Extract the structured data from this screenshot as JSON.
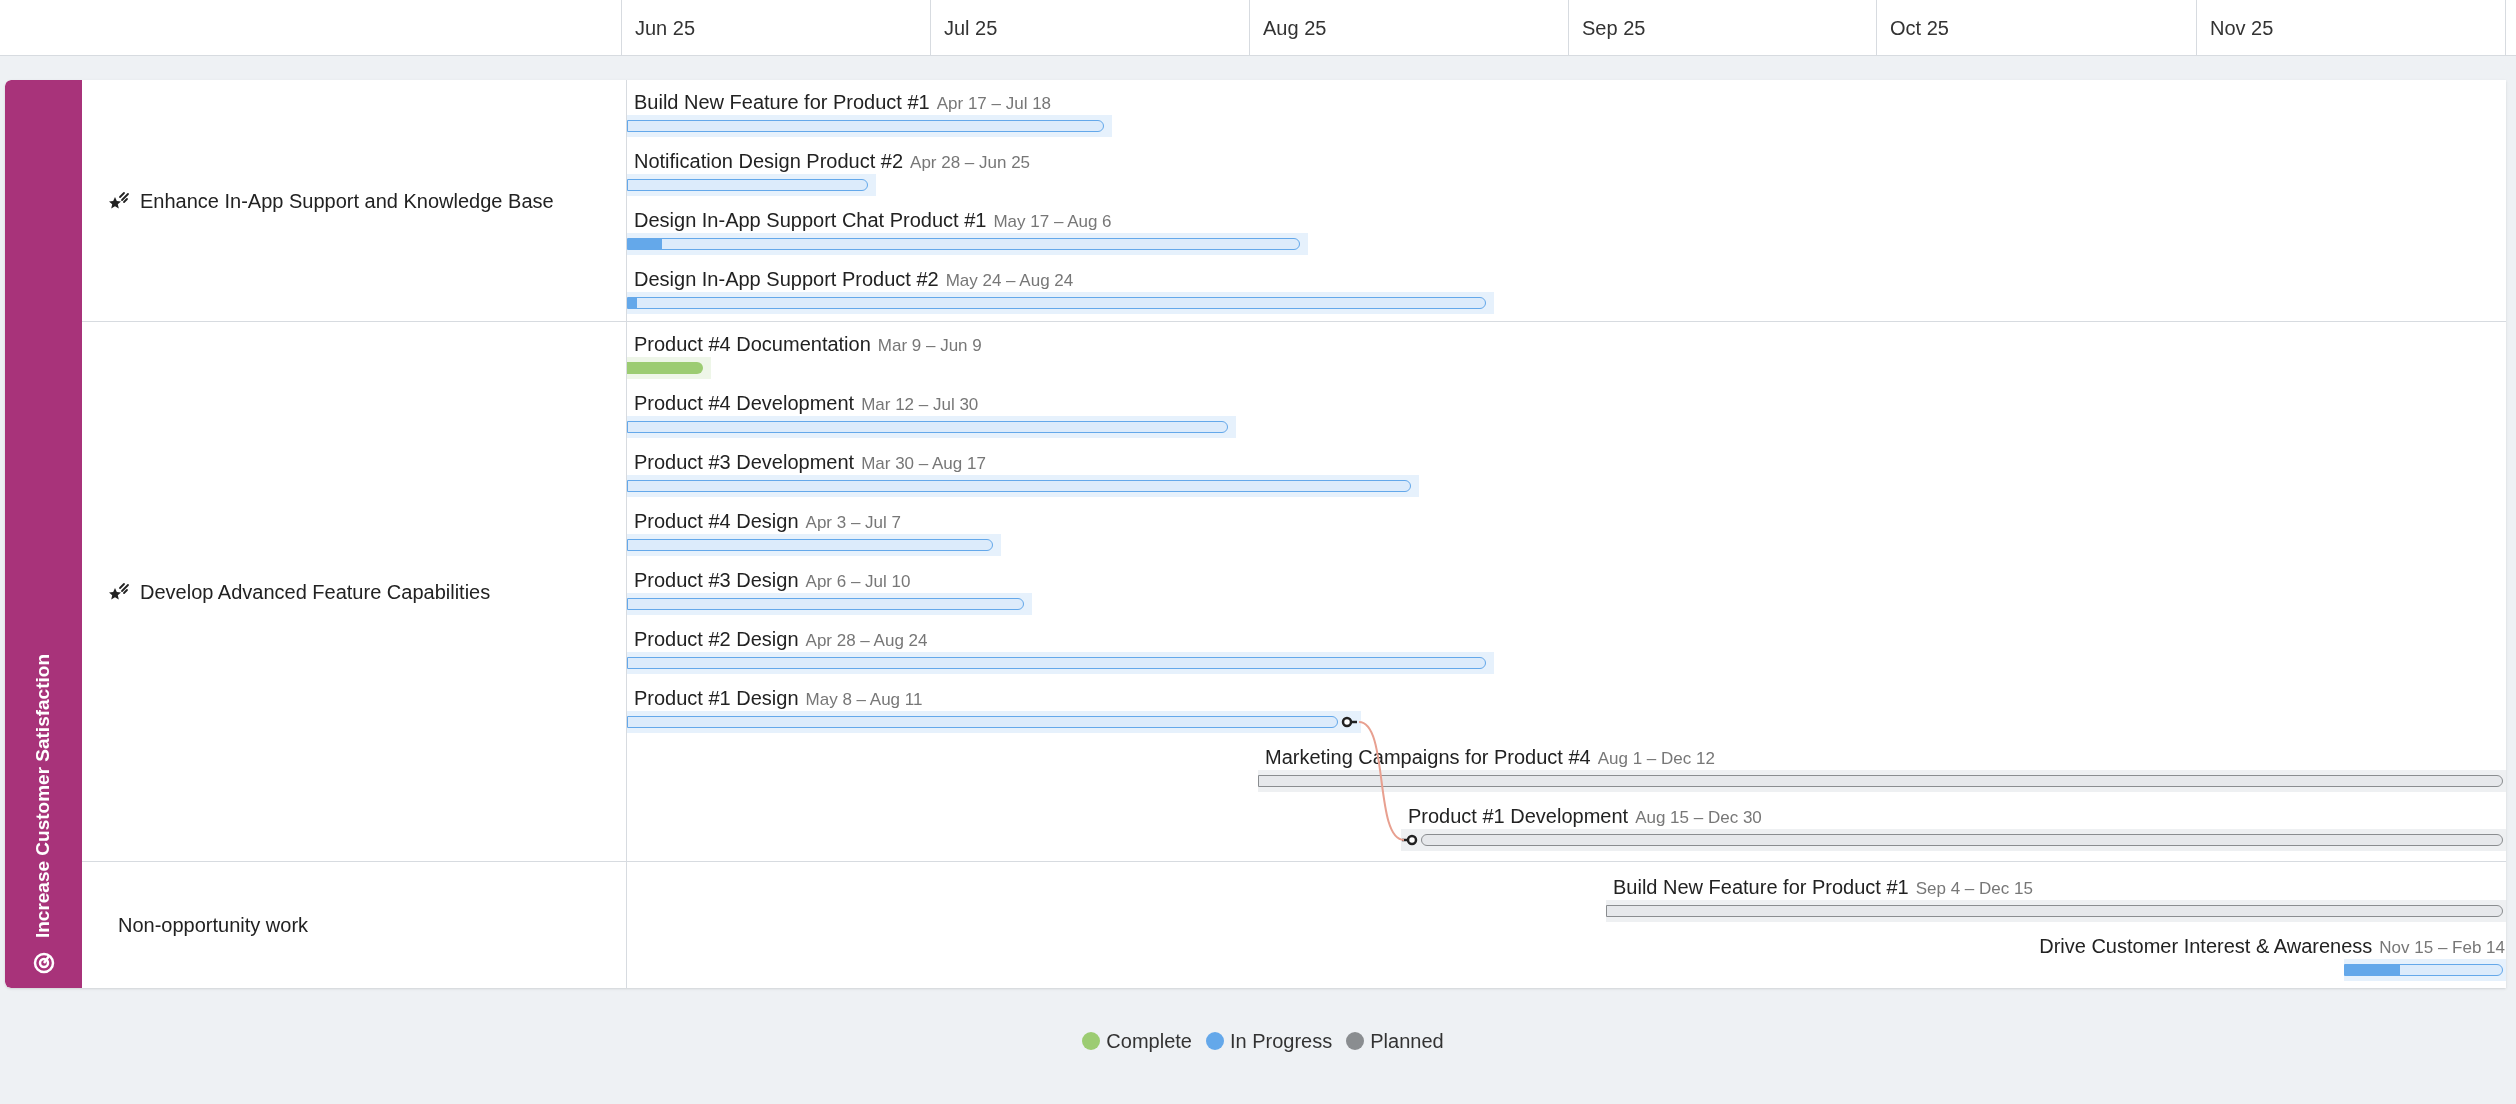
{
  "timeline_header": {
    "months": [
      "Jun 25",
      "Jul 25",
      "Aug 25",
      "Sep 25",
      "Oct 25",
      "Nov 25"
    ]
  },
  "goal": {
    "title": "Increase Customer Satisfaction"
  },
  "groups": [
    {
      "name": "Enhance In-App Support and Knowledge Base",
      "kind": "opportunity",
      "tasks": [
        {
          "name": "Build New Feature for Product #1",
          "dates": "Apr 17 – Jul 18",
          "kind": "in_progress"
        },
        {
          "name": "Notification Design Product #2",
          "dates": "Apr 28 – Jun 25",
          "kind": "in_progress"
        },
        {
          "name": "Design In-App Support Chat Product #1",
          "dates": "May 17 – Aug 6",
          "kind": "in_progress",
          "level": 0.05
        },
        {
          "name": "Design In-App Support Product #2",
          "dates": "May 24 – Aug 24",
          "kind": "in_progress",
          "level": 0.01
        }
      ]
    },
    {
      "name": "Develop Advanced Feature Capabilities",
      "kind": "opportunity",
      "tasks": [
        {
          "name": "Product #4 Documentation",
          "dates": "Mar 9 – Jun 9",
          "kind": "complete"
        },
        {
          "name": "Product #4 Development",
          "dates": "Mar 12 – Jul 30",
          "kind": "in_progress"
        },
        {
          "name": "Product #3 Development",
          "dates": "Mar 30 – Aug 17",
          "kind": "in_progress"
        },
        {
          "name": "Product #4 Design",
          "dates": "Apr 3 – Jul 7",
          "kind": "in_progress"
        },
        {
          "name": "Product #3 Design",
          "dates": "Apr 6 – Jul 10",
          "kind": "in_progress"
        },
        {
          "name": "Product #2 Design",
          "dates": "Apr 28 – Aug 24",
          "kind": "in_progress"
        },
        {
          "name": "Product #1 Design",
          "dates": "May 8 – Aug 11",
          "kind": "in_progress",
          "link_out": true
        },
        {
          "name": "Marketing Campaigns for Product #4",
          "dates": "Aug 1 – Dec 12",
          "kind": "planned"
        },
        {
          "name": "Product #1 Development",
          "dates": "Aug 15 – Dec 30",
          "kind": "planned",
          "link_in": true
        }
      ]
    },
    {
      "name": "Non-opportunity work",
      "kind": "other",
      "tasks": [
        {
          "name": "Build New Feature for Product #1",
          "dates": "Sep 4 – Dec 15",
          "kind": "planned"
        },
        {
          "name": "Drive Customer Interest & Awareness",
          "dates": "Nov 15 – Feb 14",
          "kind": "in_progress",
          "level": 0.35
        }
      ]
    }
  ],
  "legend": [
    {
      "label": "Complete",
      "color": "#9ccc72"
    },
    {
      "label": "In Progress",
      "color": "#64a8ea"
    },
    {
      "label": "Planned",
      "color": "#8a8d90"
    }
  ]
}
